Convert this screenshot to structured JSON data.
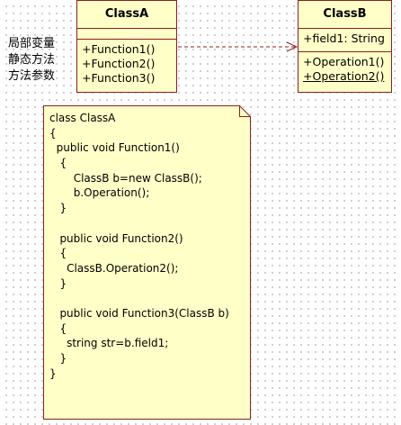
{
  "class_a": {
    "name": "ClassA",
    "operations": [
      "+Function1()",
      "+Function2()",
      "+Function3()"
    ]
  },
  "class_b": {
    "name": "ClassB",
    "attributes": [
      "+field1: String"
    ],
    "operations": [
      "+Operation1()",
      "+Operation2()"
    ]
  },
  "side_notes": [
    "局部变量",
    "静态方法",
    "方法参数"
  ],
  "note": {
    "lines": [
      "class ClassA",
      "{",
      "  public void Function1()",
      "   {",
      "       ClassB b=new ClassB();",
      "       b.Operation();",
      "   }",
      "",
      "   public void Function2()",
      "   {",
      "     ClassB.Operation2();",
      "   }",
      "",
      "   public void Function3(ClassB b)",
      "   {",
      "     string str=b.field1;",
      "   }",
      "}"
    ]
  },
  "colors": {
    "class_fill": "#ffffc8",
    "class_border": "#8a2020",
    "dependency_line": "#8a2020",
    "grid_dots": "#c4c4c4"
  },
  "relationship": {
    "type": "dependency",
    "from": "ClassA",
    "to": "ClassB"
  }
}
